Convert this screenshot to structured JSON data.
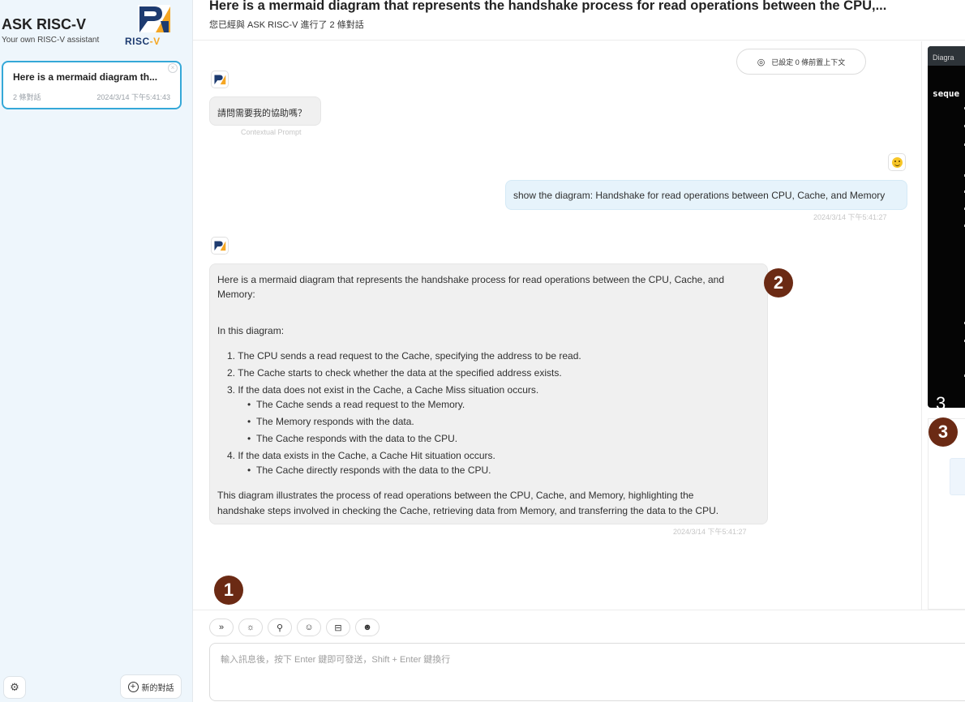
{
  "sidebar": {
    "brand_title": "ASK RISC-V",
    "brand_subtitle": "Your own RISC-V assistant",
    "logo_word_main": "RISC",
    "logo_word_accent": "-V",
    "chats": [
      {
        "title": "Here is a mermaid diagram th...",
        "count": "2 條對話",
        "time": "2024/3/14 下午5:41:43"
      }
    ],
    "new_chat_label": "新的對話"
  },
  "header": {
    "title": "Here is a mermaid diagram that represents the handshake process for read operations between the CPU,...",
    "subtitle": "您已經與 ASK RISC-V 進行了 2 條對話"
  },
  "chat": {
    "context_pill": "已設定 0 條前置上下文",
    "prompt_message": "請問需要我的協助嗎？",
    "prompt_caption": "Contextual Prompt",
    "user_message": "show the diagram: Handshake for read operations between CPU, Cache, and Memory",
    "user_time": "2024/3/14 下午5:41:27",
    "bot_reply": {
      "intro_line1": "Here is a mermaid diagram that represents the handshake process for read operations between the CPU, Cache, and",
      "intro_line2": "Memory:",
      "section": "In this diagram:",
      "items": [
        "1. The CPU sends a read request to the Cache, specifying the address to be read.",
        "2. The Cache starts to check whether the data at the specified address exists.",
        "3. If the data does not exist in the Cache, a Cache Miss situation occurs.",
        "The Cache sends a read request to the Memory.",
        "The Memory responds with the data.",
        "The Cache responds with the data to the CPU.",
        "4. If the data exists in the Cache, a Cache Hit situation occurs.",
        "The Cache directly responds with the data to the CPU."
      ],
      "outro_line1": "This diagram illustrates the process of read operations between the CPU, Cache, and Memory, highlighting the",
      "outro_line2": "handshake steps involved in checking the Cache, retrieving data from Memory, and transferring the data to the CPU.",
      "time": "2024/3/14 下午5:41:27"
    }
  },
  "annotations": {
    "one": "1",
    "two": "2",
    "three": "3"
  },
  "right_panel": {
    "tab_label": "Diagra",
    "code_first_word": "seque",
    "code_badge": "3"
  },
  "composer": {
    "tools": [
      "»",
      "☼",
      "⚲",
      "☺",
      "⊟",
      "☻"
    ],
    "placeholder": "輸入訊息後，按下 Enter 鍵即可發送，Shift + Enter 鍵換行"
  },
  "colors": {
    "accent": "#35a8d8",
    "badge": "#6b2a14",
    "code_bg": "#050505",
    "user_bubble": "#e6f3fb",
    "bot_bubble": "#f0f0f0"
  },
  "icons": {
    "settings": "settings-icon",
    "new_chat": "plus-circle-icon",
    "context": "brain-icon",
    "user_avatar": "smiley-icon",
    "bot_avatar": "risc-v-logo-icon"
  }
}
